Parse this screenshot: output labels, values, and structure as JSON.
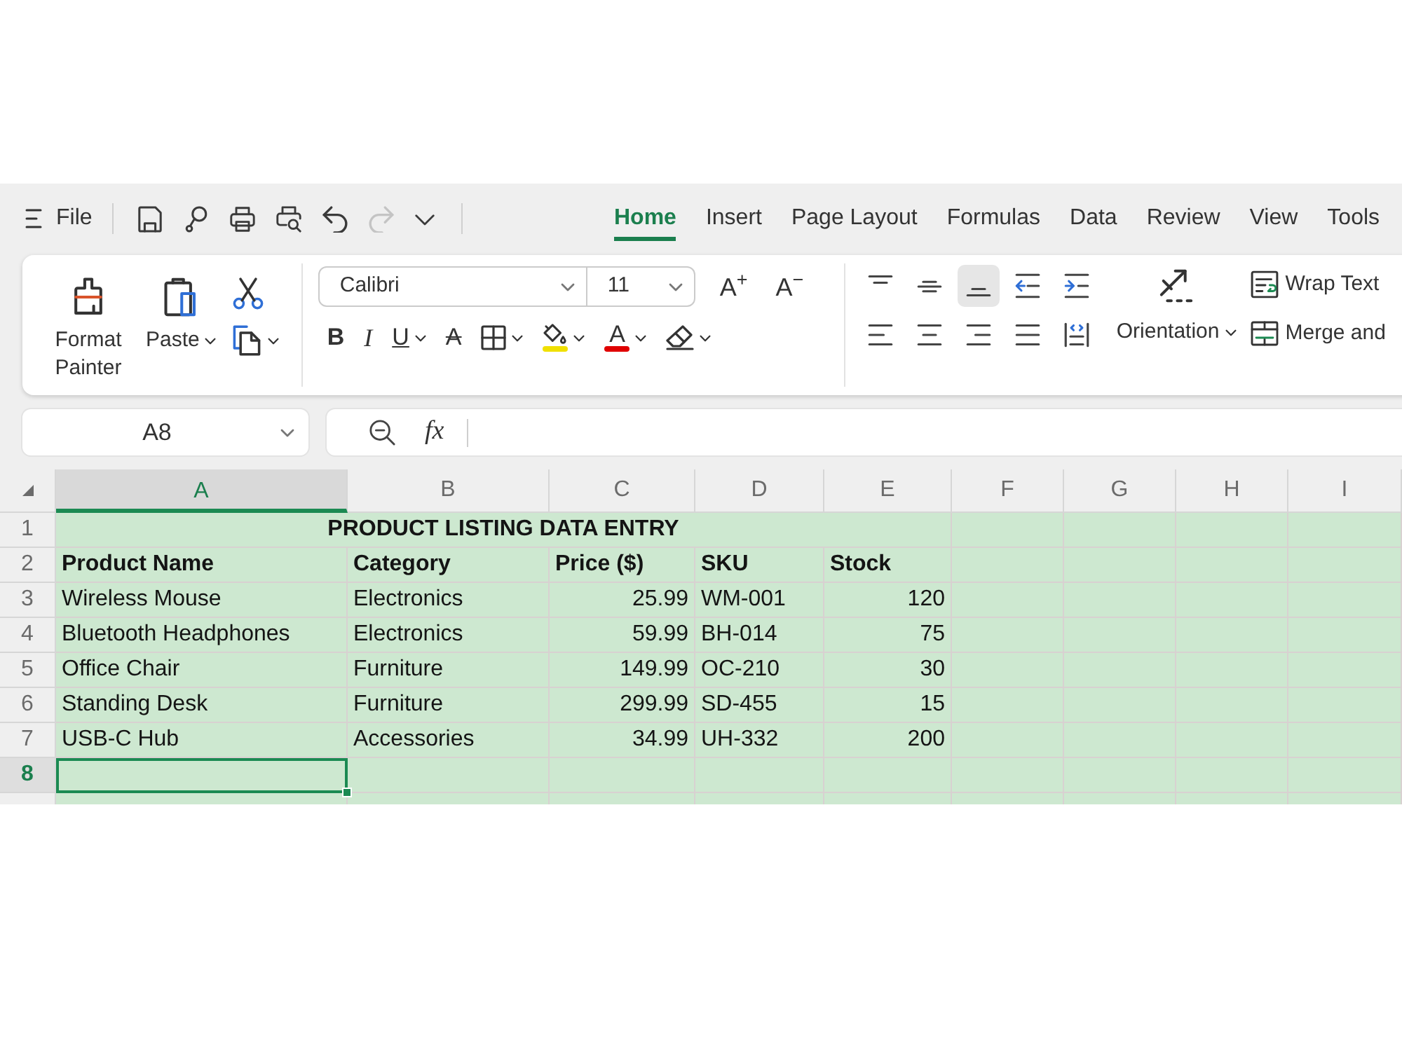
{
  "toolbar": {
    "menu_label": "File",
    "quick_tools": [
      {
        "kind": "save",
        "disabled": false
      },
      {
        "kind": "lasso",
        "disabled": false
      },
      {
        "kind": "print",
        "disabled": false
      },
      {
        "kind": "print-preview",
        "disabled": false
      },
      {
        "kind": "undo",
        "disabled": false
      },
      {
        "kind": "redo",
        "disabled": true
      },
      {
        "kind": "more",
        "disabled": false
      }
    ]
  },
  "tabs": [
    {
      "label": "Home",
      "selected": true
    },
    {
      "label": "Insert",
      "selected": false
    },
    {
      "label": "Page Layout",
      "selected": false
    },
    {
      "label": "Formulas",
      "selected": false
    },
    {
      "label": "Data",
      "selected": false
    },
    {
      "label": "Review",
      "selected": false
    },
    {
      "label": "View",
      "selected": false
    },
    {
      "label": "Tools",
      "selected": false
    }
  ],
  "ribbon": {
    "clipboard": {
      "format_painter": "Format Painter",
      "paste": "Paste"
    },
    "font": {
      "name": "Calibri",
      "size": "11",
      "size_buttons": [
        "A$^{+}$",
        "A$^{−}$"
      ],
      "style_buttons": [
        {
          "kind": "bold",
          "glyph": "B",
          "dropdown": false
        },
        {
          "kind": "italic",
          "glyph": "I",
          "dropdown": false
        },
        {
          "kind": "underline",
          "glyph": "U",
          "dropdown": true
        },
        {
          "kind": "strikethrough",
          "glyph": "A",
          "dropdown": false
        },
        {
          "kind": "borders",
          "dropdown": true
        },
        {
          "kind": "fill-color",
          "color": "#f0e000",
          "dropdown": true
        },
        {
          "kind": "font-color",
          "glyph": "A",
          "color": "#e00000",
          "dropdown": true
        },
        {
          "kind": "eraser",
          "dropdown": true
        }
      ]
    },
    "alignment": [
      {
        "kind": "top",
        "selected": false
      },
      {
        "kind": "middle",
        "selected": false
      },
      {
        "kind": "bottom",
        "selected": true
      },
      {
        "kind": "indent-decrease",
        "selected": false
      },
      {
        "kind": "indent-increase",
        "selected": false
      },
      {
        "kind": "left",
        "selected": false
      },
      {
        "kind": "center",
        "selected": false
      },
      {
        "kind": "right",
        "selected": false
      },
      {
        "kind": "justify",
        "selected": false
      },
      {
        "kind": "distributed",
        "selected": false
      }
    ],
    "orientation": "Orientation",
    "wrap_text": "Wrap Text",
    "merge": "Merge and"
  },
  "name_box": {
    "value": "A8"
  },
  "formula_bar": {
    "function_label": "fx"
  },
  "sheet": {
    "columns": [
      {
        "label": "A",
        "selected": true
      },
      {
        "label": "B",
        "selected": false
      },
      {
        "label": "C",
        "selected": false
      },
      {
        "label": "D",
        "selected": false
      },
      {
        "label": "E",
        "selected": false
      },
      {
        "label": "F",
        "selected": false
      },
      {
        "label": "G",
        "selected": false
      },
      {
        "label": "H",
        "selected": false
      },
      {
        "label": "I",
        "selected": false
      }
    ],
    "rows": [
      {
        "number": "1",
        "kind": "title",
        "selected": false,
        "text": "PRODUCT LISTING DATA ENTRY"
      },
      {
        "number": "2",
        "kind": "header",
        "selected": false,
        "cells": [
          {
            "text": "Product Name",
            "kind": "text"
          },
          {
            "text": "Category",
            "kind": "text"
          },
          {
            "text": "Price ($)",
            "kind": "text"
          },
          {
            "text": "SKU",
            "kind": "text"
          },
          {
            "text": "Stock",
            "kind": "text"
          }
        ]
      },
      {
        "number": "3",
        "kind": "data",
        "selected": false,
        "cells": [
          {
            "text": "Wireless Mouse",
            "kind": "text"
          },
          {
            "text": "Electronics",
            "kind": "text"
          },
          {
            "text": "25.99",
            "kind": "number"
          },
          {
            "text": "WM-001",
            "kind": "text"
          },
          {
            "text": "120",
            "kind": "number"
          }
        ]
      },
      {
        "number": "4",
        "kind": "data",
        "selected": false,
        "cells": [
          {
            "text": "Bluetooth Headphones",
            "kind": "text"
          },
          {
            "text": "Electronics",
            "kind": "text"
          },
          {
            "text": "59.99",
            "kind": "number"
          },
          {
            "text": "BH-014",
            "kind": "text"
          },
          {
            "text": "75",
            "kind": "number"
          }
        ]
      },
      {
        "number": "5",
        "kind": "data",
        "selected": false,
        "cells": [
          {
            "text": "Office Chair",
            "kind": "text"
          },
          {
            "text": "Furniture",
            "kind": "text"
          },
          {
            "text": "149.99",
            "kind": "number"
          },
          {
            "text": "OC-210",
            "kind": "text"
          },
          {
            "text": "30",
            "kind": "number"
          }
        ]
      },
      {
        "number": "6",
        "kind": "data",
        "selected": false,
        "cells": [
          {
            "text": "Standing Desk",
            "kind": "text"
          },
          {
            "text": "Furniture",
            "kind": "text"
          },
          {
            "text": "299.99",
            "kind": "number"
          },
          {
            "text": "SD-455",
            "kind": "text"
          },
          {
            "text": "15",
            "kind": "number"
          }
        ]
      },
      {
        "number": "7",
        "kind": "data",
        "selected": false,
        "cells": [
          {
            "text": "USB-C Hub",
            "kind": "text"
          },
          {
            "text": "Accessories",
            "kind": "text"
          },
          {
            "text": "34.99",
            "kind": "number"
          },
          {
            "text": "UH-332",
            "kind": "text"
          },
          {
            "text": "200",
            "kind": "number"
          }
        ]
      },
      {
        "number": "8",
        "kind": "empty",
        "selected": true
      }
    ]
  }
}
